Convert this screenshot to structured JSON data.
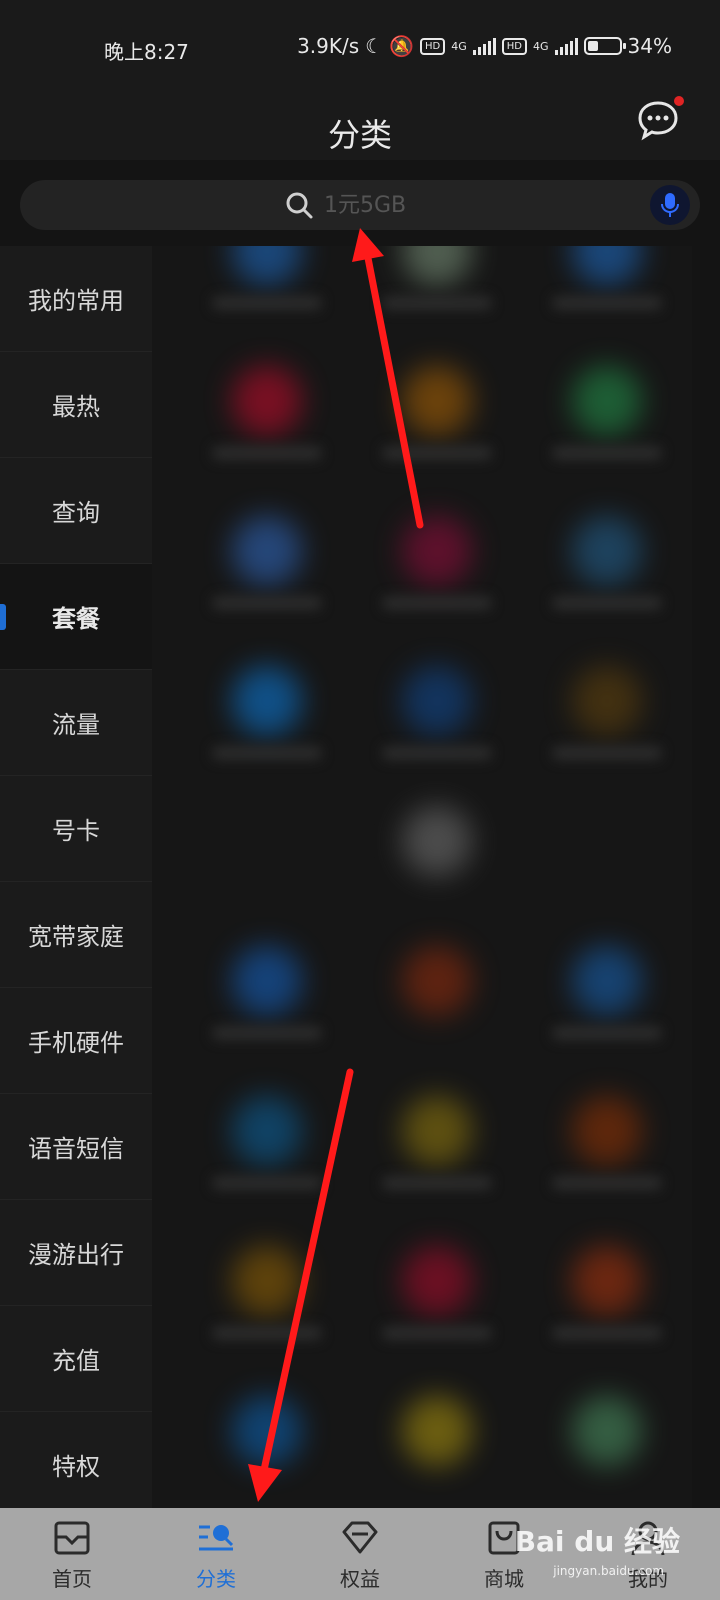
{
  "status_bar": {
    "time": "晚上8:27",
    "speed": "3.9K/s",
    "hd1": "HD",
    "net1": "4G",
    "hd2": "HD",
    "net2": "4G",
    "battery_text": "34%",
    "battery_level": 0.34
  },
  "header": {
    "title": "分类"
  },
  "search": {
    "placeholder": "1元5GB"
  },
  "sidebar": {
    "active_index": 3,
    "items": [
      {
        "label": "我的常用"
      },
      {
        "label": "最热"
      },
      {
        "label": "查询"
      },
      {
        "label": "套餐"
      },
      {
        "label": "流量"
      },
      {
        "label": "号卡"
      },
      {
        "label": "宽带家庭"
      },
      {
        "label": "手机硬件"
      },
      {
        "label": "语音短信"
      },
      {
        "label": "漫游出行"
      },
      {
        "label": "充值"
      },
      {
        "label": "特权"
      }
    ]
  },
  "tabbar": {
    "items": [
      {
        "label": "首页",
        "icon": "home-icon"
      },
      {
        "label": "分类",
        "icon": "category-icon"
      },
      {
        "label": "权益",
        "icon": "diamond-icon"
      },
      {
        "label": "商城",
        "icon": "shopping-bag-icon"
      },
      {
        "label": "我的",
        "icon": "user-icon"
      }
    ],
    "active_index": 1
  },
  "watermark": {
    "brand": "Bai du 经验",
    "url": "jingyan.baidu.com"
  },
  "colors": {
    "accent": "#1f6fd6",
    "annotation": "#ff1a1a"
  }
}
